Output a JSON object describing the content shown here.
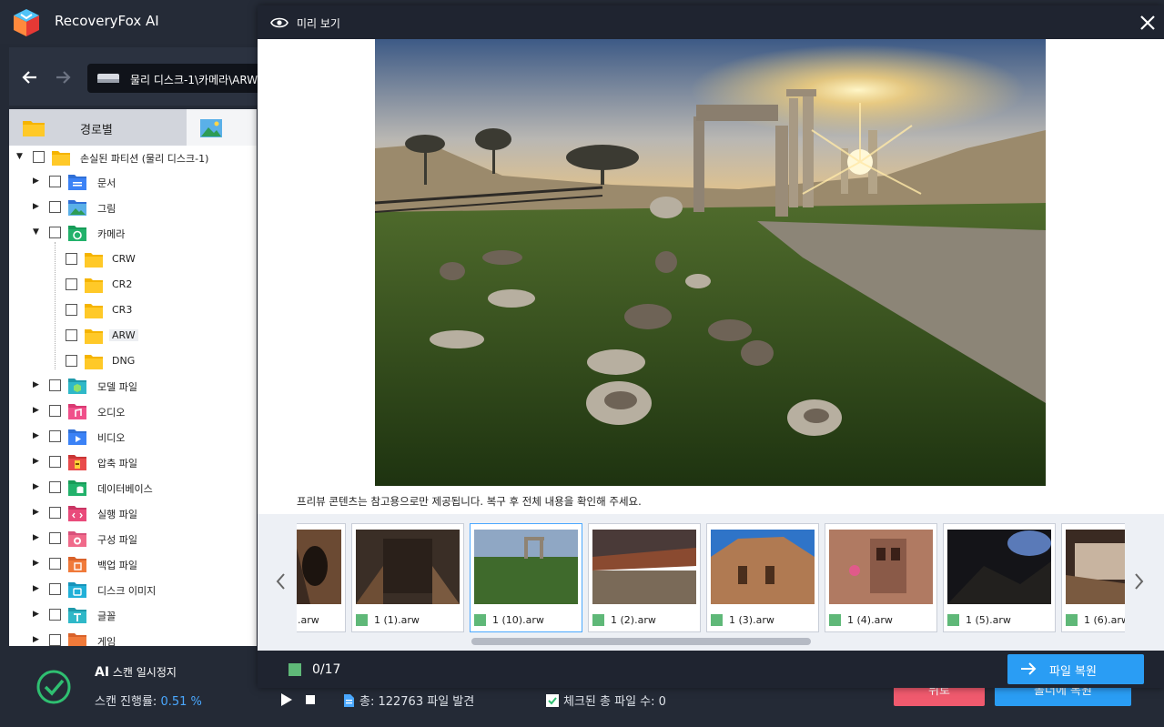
{
  "app": {
    "title": "RecoveryFox AI"
  },
  "nav": {
    "path": "물리 디스크-1\\카메라\\ARW"
  },
  "tabs": {
    "by_path": "경로별"
  },
  "tree": {
    "root": "손실된 파티션 (물리 디스크-1)",
    "items": [
      {
        "label": "문서",
        "icon": "document-folder-icon",
        "color": "#3b82f6"
      },
      {
        "label": "그림",
        "icon": "picture-folder-icon",
        "color": "#3b82f6"
      },
      {
        "label": "카메라",
        "icon": "camera-folder-icon",
        "color": "#22b26b"
      }
    ],
    "camera_children": [
      "CRW",
      "CR2",
      "CR3",
      "ARW",
      "DNG"
    ],
    "rest": [
      {
        "label": "모델 파일",
        "icon": "model-folder-icon",
        "color": "#2fb8c8"
      },
      {
        "label": "오디오",
        "icon": "audio-folder-icon",
        "color": "#f0508a"
      },
      {
        "label": "비디오",
        "icon": "video-folder-icon",
        "color": "#3b82f6"
      },
      {
        "label": "압축 파일",
        "icon": "archive-folder-icon",
        "color": "#e94b4b"
      },
      {
        "label": "데이터베이스",
        "icon": "database-folder-icon",
        "color": "#22b26b"
      },
      {
        "label": "실행 파일",
        "icon": "executable-folder-icon",
        "color": "#e94b7b"
      },
      {
        "label": "구성 파일",
        "icon": "config-folder-icon",
        "color": "#f06a8a"
      },
      {
        "label": "백업 파일",
        "icon": "backup-folder-icon",
        "color": "#f07a3a"
      },
      {
        "label": "디스크 이미지",
        "icon": "disk-image-folder-icon",
        "color": "#21b0d8"
      },
      {
        "label": "글꼴",
        "icon": "font-folder-icon",
        "color": "#2fb8c8"
      },
      {
        "label": "게임",
        "icon": "game-folder-icon",
        "color": "#f07a3a"
      }
    ]
  },
  "status": {
    "ai": "AI",
    "title": "스캔 일시정지",
    "progress_label": "스캔 진행률:",
    "progress_value": "0.51 %",
    "total_found": "총: 122763 파일 발견",
    "checked_total": "체크된 총 파일 수: 0",
    "back_label": "뒤로",
    "next_label": "폴더에 복원"
  },
  "preview": {
    "title": "미리 보기",
    "notice": "프리뷰 콘텐츠는 참고용으로만 제공됩니다. 복구 후 전체 내용을 확인해 주세요.",
    "thumbnails": [
      ".arw",
      "1 (1).arw",
      "1 (10).arw",
      "1 (2).arw",
      "1 (3).arw",
      "1 (4).arw",
      "1 (5).arw",
      "1 (6).arw"
    ],
    "active_index": 2,
    "count": "0/17",
    "recover_label": "파일 복원"
  },
  "colors": {
    "accent": "#2a9df4",
    "danger": "#f05a6e",
    "success": "#5fb878"
  }
}
